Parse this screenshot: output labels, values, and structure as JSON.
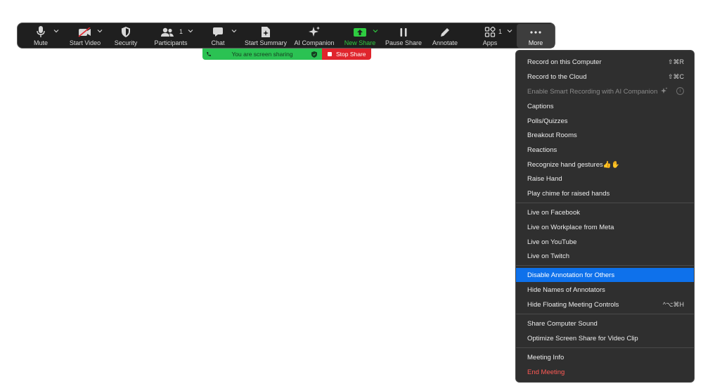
{
  "toolbar": {
    "mute": "Mute",
    "start_video": "Start Video",
    "security": "Security",
    "participants": "Participants",
    "participants_count": "1",
    "chat": "Chat",
    "start_summary": "Start Summary",
    "ai_companion": "AI Companion",
    "new_share": "New Share",
    "pause_share": "Pause Share",
    "annotate": "Annotate",
    "apps": "Apps",
    "apps_count": "1",
    "more": "More"
  },
  "share_banner": {
    "status": "You are screen sharing",
    "stop": "Stop Share"
  },
  "menu": {
    "record_computer": "Record on this Computer",
    "record_computer_sc": "⇧⌘R",
    "record_cloud": "Record to the Cloud",
    "record_cloud_sc": "⇧⌘C",
    "smart_recording": "Enable Smart Recording with AI Companion",
    "captions": "Captions",
    "polls": "Polls/Quizzes",
    "breakout": "Breakout Rooms",
    "reactions": "Reactions",
    "hand_gestures": "Recognize hand gestures👍✋",
    "raise_hand": "Raise Hand",
    "chime": "Play chime for raised hands",
    "facebook": "Live on Facebook",
    "workplace": "Live on Workplace from Meta",
    "youtube": "Live on YouTube",
    "twitch": "Live on Twitch",
    "disable_annotation": "Disable Annotation for Others",
    "hide_names": "Hide Names of Annotators",
    "hide_controls": "Hide Floating Meeting Controls",
    "hide_controls_sc": "^⌥⌘H",
    "share_sound": "Share Computer Sound",
    "optimize_video": "Optimize Screen Share for Video Clip",
    "meeting_info": "Meeting Info",
    "end_meeting": "End Meeting"
  },
  "colors": {
    "toolbar_bg": "#1f1f1f",
    "accent_green": "#2ecc40",
    "stop_red": "#e0252d",
    "selected_blue": "#0e71eb",
    "danger_red": "#ff5a55"
  }
}
